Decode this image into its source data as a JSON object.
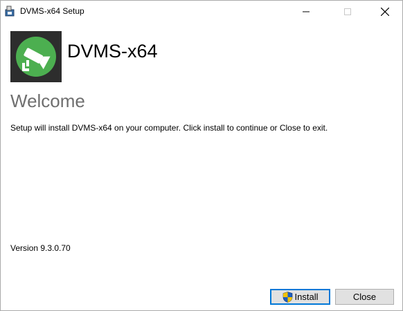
{
  "window": {
    "title": "DVMS-x64 Setup",
    "controls": {
      "minimize_icon": "minimize-icon",
      "maximize_icon": "maximize-icon",
      "close_icon": "close-icon"
    }
  },
  "header": {
    "logo_icon": "camera-icon",
    "product_name": "DVMS-x64"
  },
  "main": {
    "heading": "Welcome",
    "description": "Setup will install DVMS-x64 on your computer. Click install to continue or Close to exit.",
    "version": "Version 9.3.0.70"
  },
  "buttons": {
    "install_label": "Install",
    "install_icon": "shield-icon",
    "close_label": "Close"
  },
  "colors": {
    "logo_background": "#2d2d2d",
    "logo_green": "#4caf50",
    "welcome_text": "#6f6f6f",
    "default_button_border": "#0078d7"
  }
}
